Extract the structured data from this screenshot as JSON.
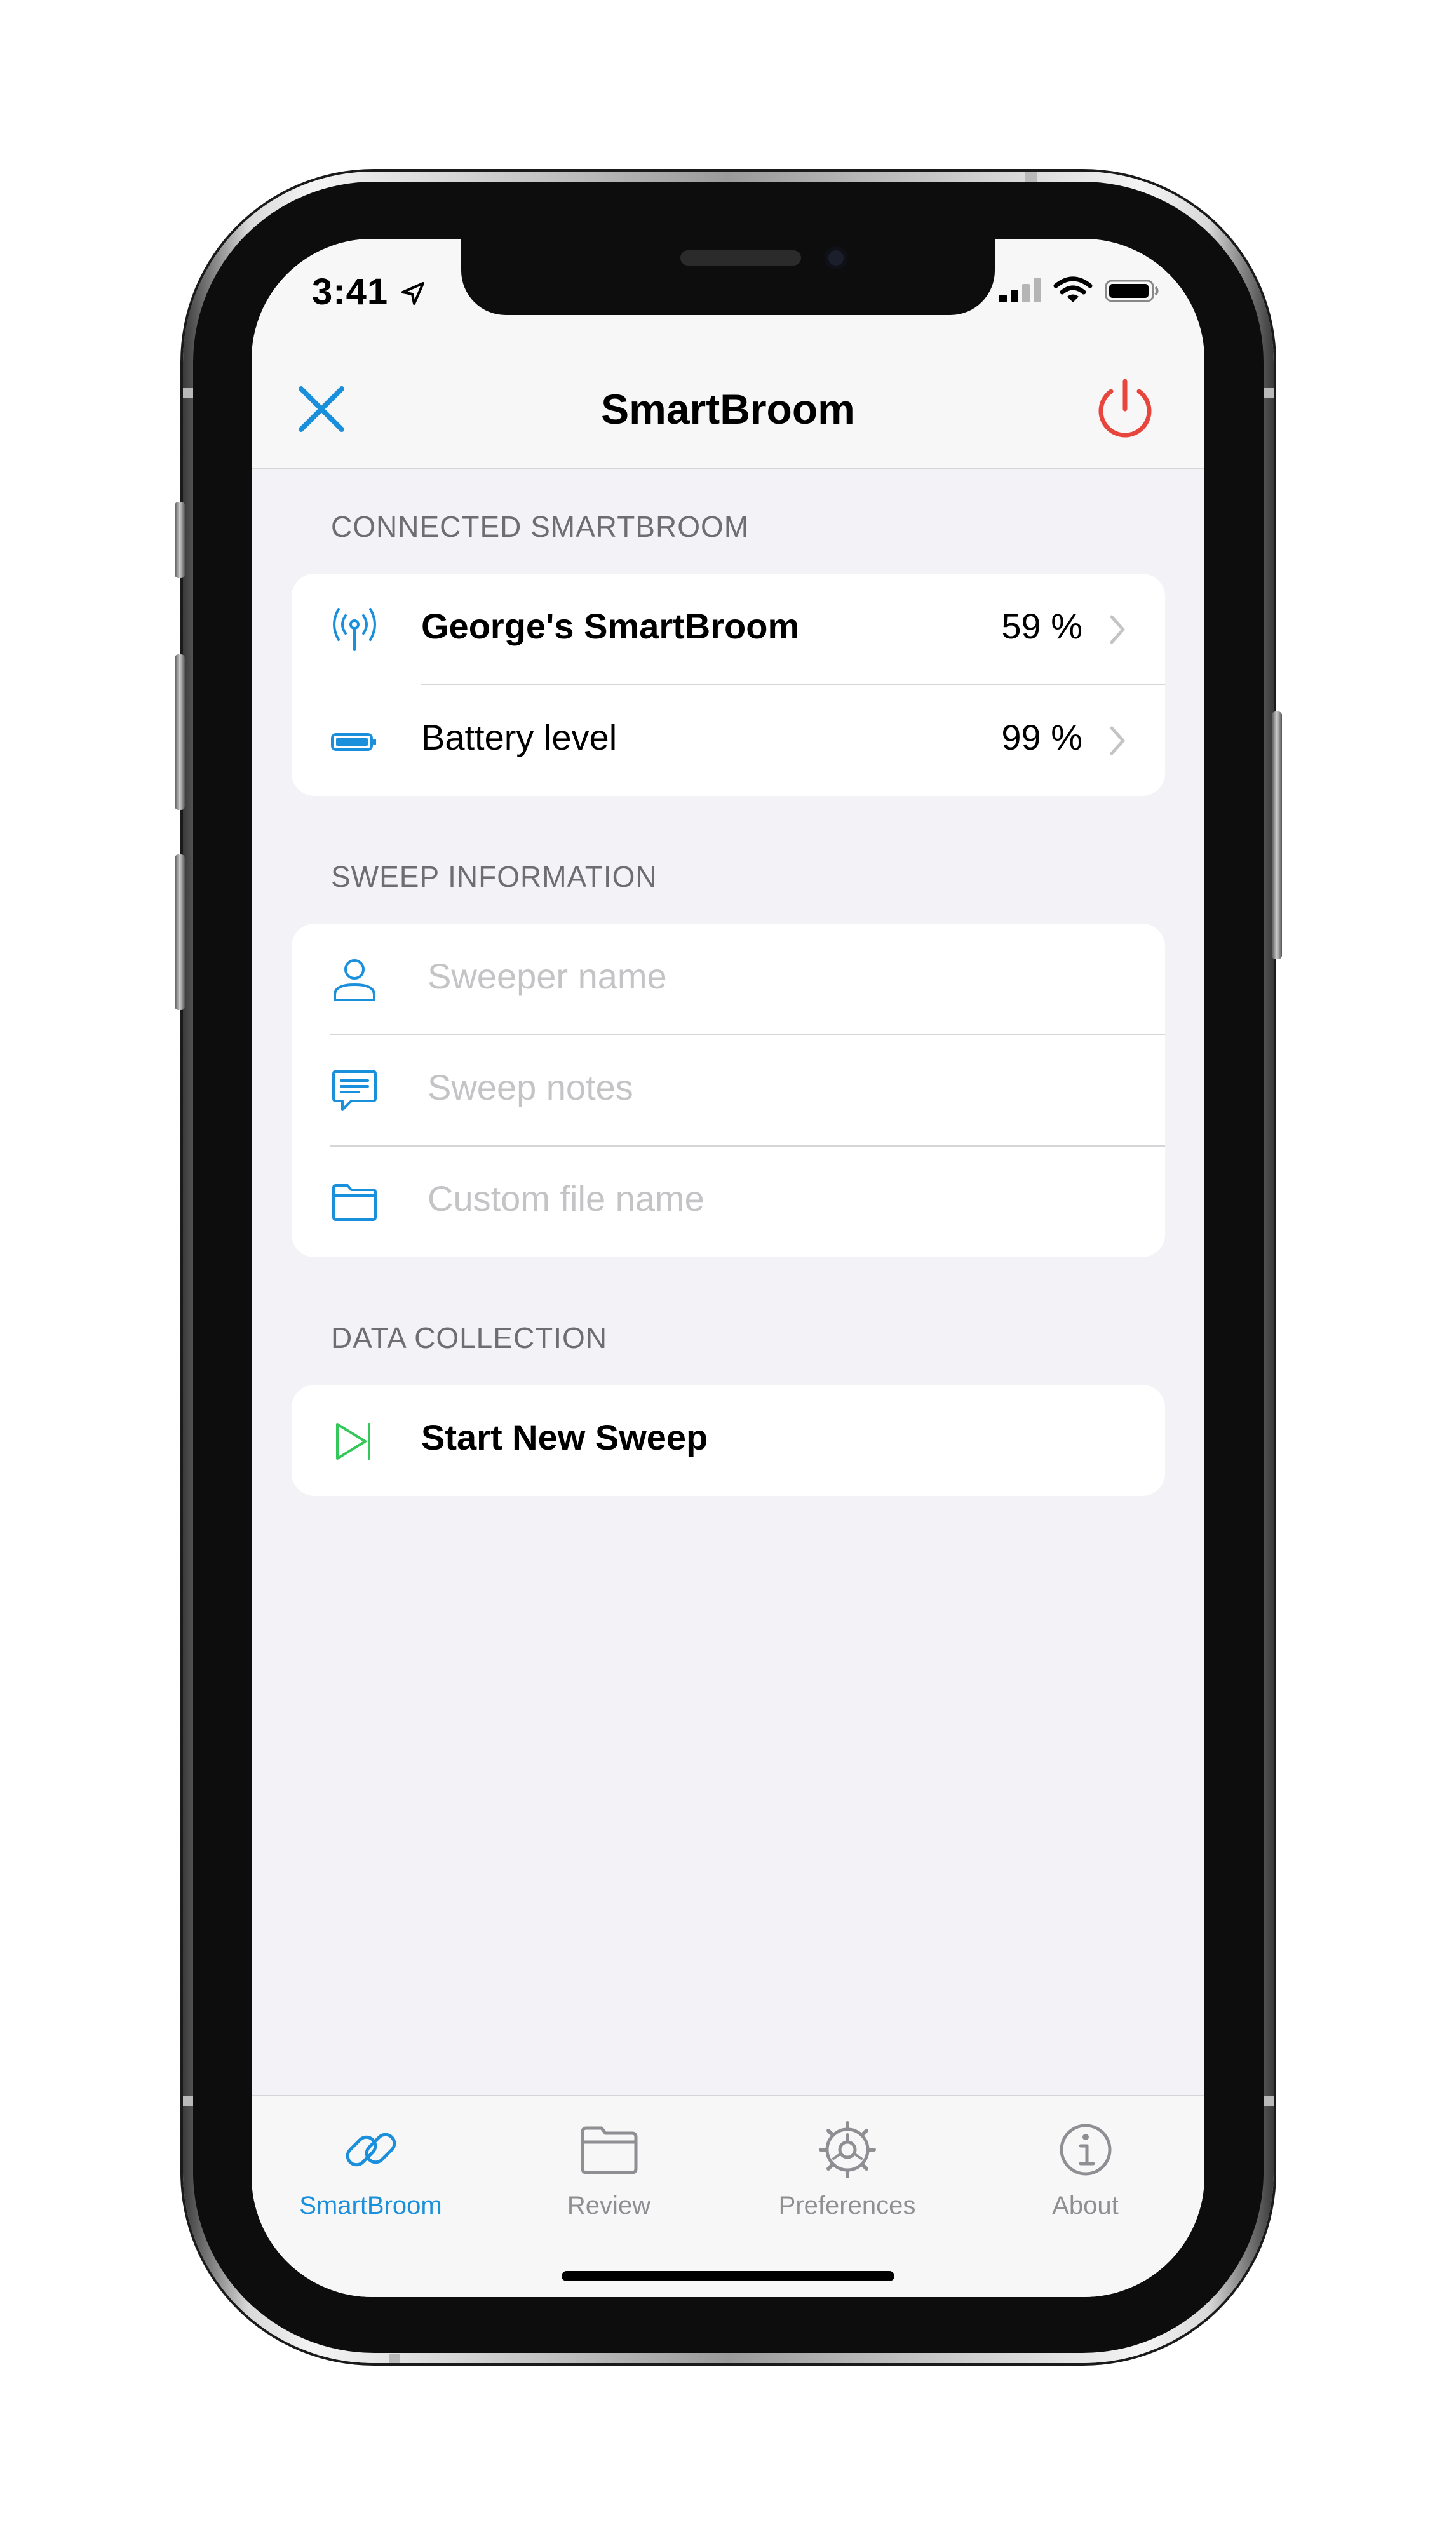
{
  "colors": {
    "accent": "#1a8fdb",
    "danger": "#e8453c",
    "success": "#34c759",
    "placeholder": "#c4c4c7"
  },
  "status_bar": {
    "time": "3:41",
    "icons": [
      "location-arrow-icon",
      "cellular-signal-icon",
      "wifi-icon",
      "battery-icon"
    ]
  },
  "nav": {
    "title": "SmartBroom",
    "left_icon": "close-icon",
    "right_icon": "power-icon"
  },
  "connected": {
    "header": "CONNECTED SMARTBROOM",
    "rows": [
      {
        "icon": "antenna-signal-icon",
        "label": "George's SmartBroom",
        "value": "59 %"
      },
      {
        "icon": "battery-icon",
        "label": "Battery level",
        "value": "99 %"
      }
    ]
  },
  "sweep": {
    "header": "SWEEP INFORMATION",
    "fields": [
      {
        "icon": "person-icon",
        "placeholder": "Sweeper name"
      },
      {
        "icon": "speech-bubble-icon",
        "placeholder": "Sweep notes"
      },
      {
        "icon": "folder-icon",
        "placeholder": "Custom file name"
      }
    ]
  },
  "data_collection": {
    "header": "DATA COLLECTION",
    "action": {
      "icon": "play-skip-icon",
      "label": "Start New Sweep"
    }
  },
  "tabs": [
    {
      "icon": "link-icon",
      "label": "SmartBroom",
      "active": true
    },
    {
      "icon": "folder-icon",
      "label": "Review",
      "active": false
    },
    {
      "icon": "gear-icon",
      "label": "Preferences",
      "active": false
    },
    {
      "icon": "info-icon",
      "label": "About",
      "active": false
    }
  ]
}
